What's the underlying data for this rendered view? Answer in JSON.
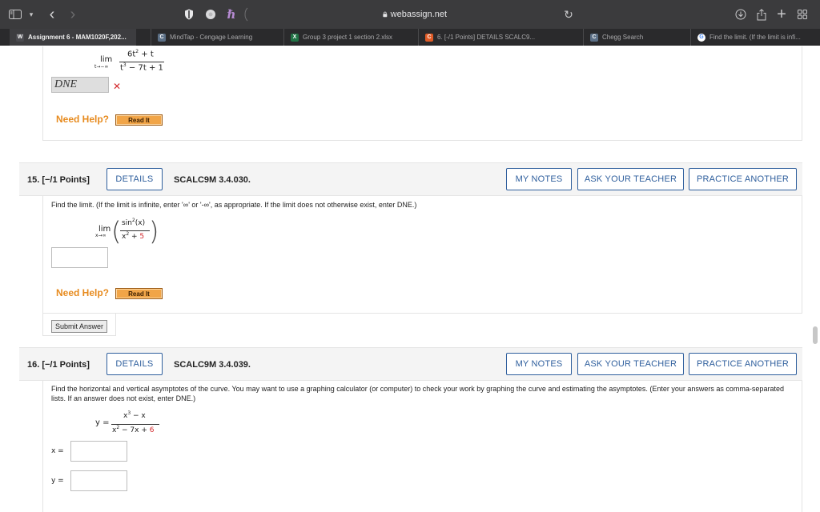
{
  "browser": {
    "address": "webassign.net",
    "tabs": [
      {
        "label": "Assignment 6 - MAM1020F,202...",
        "icon": "W",
        "color": "#4a4a4f"
      },
      {
        "label": "MindTap - Cengage Learning",
        "icon": "C",
        "color": "#5b6f86"
      },
      {
        "label": "Group 3 project 1 section 2.xlsx",
        "icon": "X",
        "color": "#217346"
      },
      {
        "label": "6. [-/1 Points] DETAILS SCALC9...",
        "icon": "C",
        "color": "#e05b26"
      },
      {
        "label": "Chegg Search",
        "icon": "C",
        "color": "#5b6f86"
      },
      {
        "label": "Find the limit. (If the limit is infi...",
        "icon": "G",
        "color": "#ffffff"
      }
    ]
  },
  "q14": {
    "lim": "lim",
    "lim_sub": "t→−∞",
    "num_a": "6t",
    "num_exp": "2",
    "num_b": " + t",
    "den_a": "t",
    "den_exp": "3",
    "den_b": " − 7t + 1",
    "answer": "DNE",
    "need_help": "Need Help?",
    "read_it": "Read It"
  },
  "q15": {
    "number": "15.  [−/1 Points]",
    "details": "DETAILS",
    "code": "SCALC9M 3.4.030.",
    "my_notes": "MY NOTES",
    "ask_teacher": "ASK YOUR TEACHER",
    "practice": "PRACTICE ANOTHER",
    "prompt": "Find the limit. (If the limit is infinite, enter '∞' or '-∞', as appropriate. If the limit does not otherwise exist, enter DNE.)",
    "lim": "lim",
    "lim_sub": "x→∞",
    "num": "sin",
    "num_exp": "2",
    "num_arg": "(x)",
    "den_a": "x",
    "den_exp": "2",
    "den_plus": " + ",
    "den_red": "5",
    "need_help": "Need Help?",
    "read_it": "Read It",
    "submit": "Submit Answer"
  },
  "q16": {
    "number": "16.  [−/1 Points]",
    "details": "DETAILS",
    "code": "SCALC9M 3.4.039.",
    "my_notes": "MY NOTES",
    "ask_teacher": "ASK YOUR TEACHER",
    "practice": "PRACTICE ANOTHER",
    "prompt": "Find the horizontal and vertical asymptotes of the curve. You may want to use a graphing calculator (or computer) to check your work by graphing the curve and estimating the asymptotes. (Enter your answers as comma-separated lists. If an answer does not exist, enter DNE.)",
    "y_eq": "y =",
    "num_a": "x",
    "num_exp": "3",
    "num_b": " − x",
    "den_a": "x",
    "den_exp": "2",
    "den_b": " − 7x + ",
    "den_red": "6",
    "x_label": "x =",
    "y_label": "y ="
  }
}
